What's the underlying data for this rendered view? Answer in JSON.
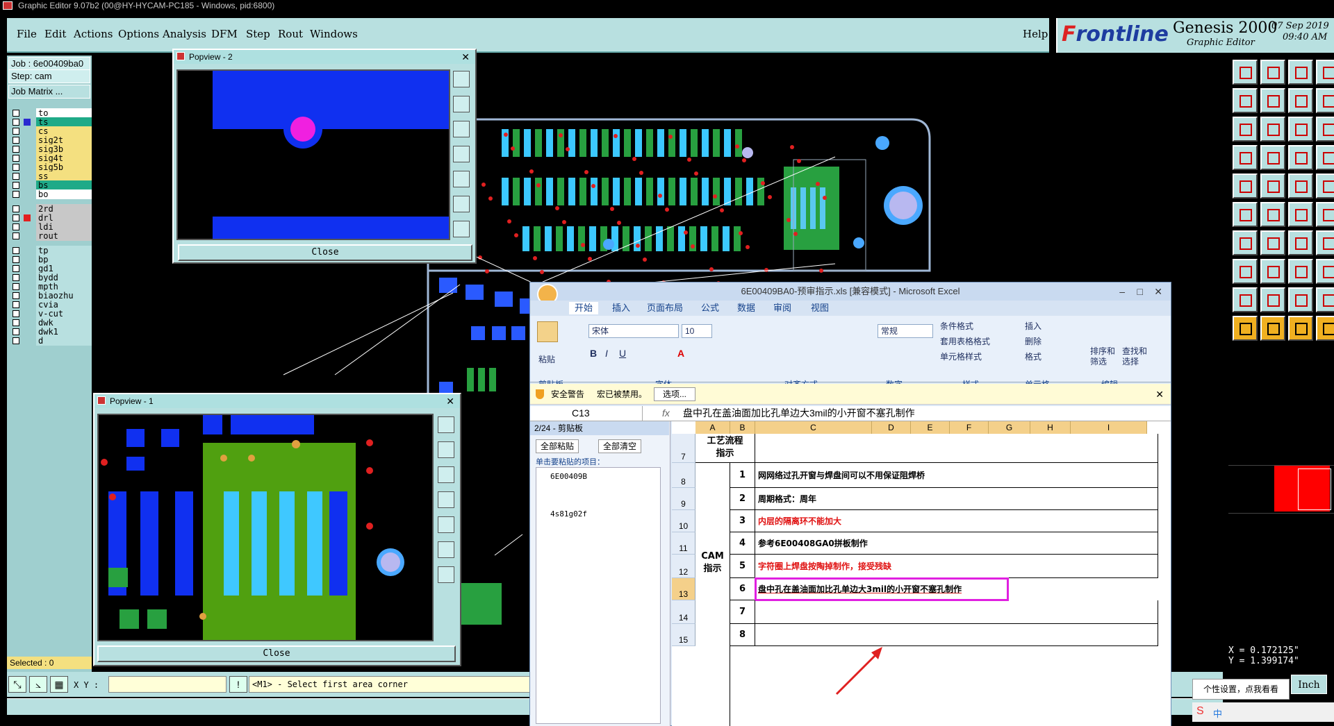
{
  "app": {
    "window_title": "Graphic Editor 9.07b2 (00@HY-HYCAM-PC185 - Windows, pid:6800)"
  },
  "menu": [
    "File",
    "Edit",
    "Actions",
    "Options",
    "Analysis",
    "DFM",
    "Step",
    "Rout",
    "Windows"
  ],
  "help": "Help",
  "brand": {
    "logo_prefix": "F",
    "logo_rest": "rontline",
    "product": "Genesis 2000",
    "subtitle": "Graphic Editor",
    "date": "07 Sep 2019",
    "time": "09:40 AM"
  },
  "job": {
    "job": "Job : 6e00409ba0",
    "step": "Step: cam",
    "matrix": "Job Matrix ..."
  },
  "layers": [
    {
      "name": "to",
      "color": "#ffffff",
      "dot": "",
      "bg": "#ffffff"
    },
    {
      "name": "ts",
      "color": "#000000",
      "dot": "#2a2ad0",
      "bg": "#1faa88"
    },
    {
      "name": "cs",
      "color": "#000000",
      "dot": "",
      "bg": "#f4e080"
    },
    {
      "name": "sig2t",
      "color": "#000000",
      "dot": "",
      "bg": "#f4e080"
    },
    {
      "name": "sig3b",
      "color": "#000000",
      "dot": "",
      "bg": "#f4e080"
    },
    {
      "name": "sig4t",
      "color": "#000000",
      "dot": "",
      "bg": "#f4e080"
    },
    {
      "name": "sig5b",
      "color": "#000000",
      "dot": "",
      "bg": "#f4e080"
    },
    {
      "name": "ss",
      "color": "#000000",
      "dot": "",
      "bg": "#f4e080"
    },
    {
      "name": "bs",
      "color": "#000000",
      "dot": "",
      "bg": "#1faa88"
    },
    {
      "name": "bo",
      "color": "#000000",
      "dot": "",
      "bg": "#ffffff"
    },
    {
      "name": "2rd",
      "color": "#000000",
      "dot": "",
      "bg": "#c8c8c8"
    },
    {
      "name": "drl",
      "color": "#000000",
      "dot": "#e22020",
      "bg": "#c8c8c8"
    },
    {
      "name": "ldi",
      "color": "#000000",
      "dot": "",
      "bg": "#c8c8c8"
    },
    {
      "name": "rout",
      "color": "#000000",
      "dot": "",
      "bg": "#c8c8c8"
    },
    {
      "name": "tp",
      "color": "#000000",
      "dot": "",
      "bg": "#b8e0e0"
    },
    {
      "name": "bp",
      "color": "#000000",
      "dot": "",
      "bg": "#b8e0e0"
    },
    {
      "name": "gd1",
      "color": "#000000",
      "dot": "",
      "bg": "#b8e0e0"
    },
    {
      "name": "bydd",
      "color": "#000000",
      "dot": "",
      "bg": "#b8e0e0"
    },
    {
      "name": "mpth",
      "color": "#000000",
      "dot": "",
      "bg": "#b8e0e0"
    },
    {
      "name": "biaozhu",
      "color": "#000000",
      "dot": "",
      "bg": "#b8e0e0"
    },
    {
      "name": "cvia",
      "color": "#000000",
      "dot": "",
      "bg": "#b8e0e0"
    },
    {
      "name": "v-cut",
      "color": "#000000",
      "dot": "",
      "bg": "#b8e0e0"
    },
    {
      "name": "dwk",
      "color": "#000000",
      "dot": "",
      "bg": "#b8e0e0"
    },
    {
      "name": "dwk1",
      "color": "#000000",
      "dot": "",
      "bg": "#b8e0e0"
    },
    {
      "name": "d",
      "color": "#000000",
      "dot": "",
      "bg": "#b8e0e0"
    }
  ],
  "selected": "Selected : 0",
  "xy_label": "X Y :",
  "xy_value": "",
  "prompt": "<M1> - Select first area corner",
  "coords": {
    "x": "X = 0.172125\"",
    "y": "Y = 1.399174\""
  },
  "units": "Inch",
  "ime_tip": "个性设置，点我看看",
  "popview2": {
    "title": "Popview - 2",
    "close": "Close"
  },
  "popview1": {
    "title": "Popview - 1",
    "close": "Close"
  },
  "excel": {
    "title": "6E00409BA0-预审指示.xls [兼容模式] - Microsoft Excel",
    "tabs": [
      "开始",
      "插入",
      "页面布局",
      "公式",
      "数据",
      "审阅",
      "视图"
    ],
    "font_name": "宋体",
    "font_size": "10",
    "number_format": "常规",
    "ribbon": {
      "paste": "粘贴",
      "cond_fmt": "条件格式",
      "table_fmt": "套用表格格式",
      "cell_style": "单元格样式",
      "insert": "插入",
      "delete": "删除",
      "format": "格式",
      "sort": "排序和\n筛选",
      "find": "查找和\n选择"
    },
    "groups": [
      "剪贴板",
      "字体",
      "对齐方式",
      "数字",
      "样式",
      "单元格",
      "编辑"
    ],
    "security": {
      "label": "安全警告",
      "text": "宏已被禁用。",
      "button": "选项..."
    },
    "name_box": "C13",
    "formula": "盘中孔在盖油面加比孔单边大3mil的小开窗不塞孔制作",
    "clipboard": {
      "title": "2/24 - 剪贴板",
      "paste_all": "全部粘贴",
      "clear_all": "全部清空",
      "hint": "单击要粘贴的项目：",
      "items": [
        "6E00409B",
        "4s81g02f"
      ]
    },
    "columns": [
      "A",
      "B",
      "C",
      "D",
      "E",
      "F",
      "G",
      "H",
      "I"
    ],
    "rows": [
      "7",
      "8",
      "9",
      "10",
      "11",
      "12",
      "13",
      "14",
      "15"
    ],
    "header_cell": "工艺流程\n指示",
    "cam_label": "CAM\n指示",
    "items": [
      {
        "num": "1",
        "text": "网网络过孔开窗与焊盘间可以不用保证阻焊桥",
        "color": "#000000"
      },
      {
        "num": "2",
        "text": "周期格式：周年",
        "color": "#000000"
      },
      {
        "num": "3",
        "text": "内层的隔离环不能加大",
        "color": "#e01010"
      },
      {
        "num": "4",
        "text": "参考6E00408GA0拼板制作",
        "color": "#000000"
      },
      {
        "num": "5",
        "text": "字符圈上焊盘按陶掉制作，接受残缺",
        "color": "#e01010"
      },
      {
        "num": "6",
        "text": "盘中孔在盖油面加比孔单边大3mil的小开窗不塞孔制作",
        "color": "#000000"
      },
      {
        "num": "7",
        "text": "",
        "color": "#000000"
      },
      {
        "num": "8",
        "text": "",
        "color": "#000000"
      }
    ]
  }
}
